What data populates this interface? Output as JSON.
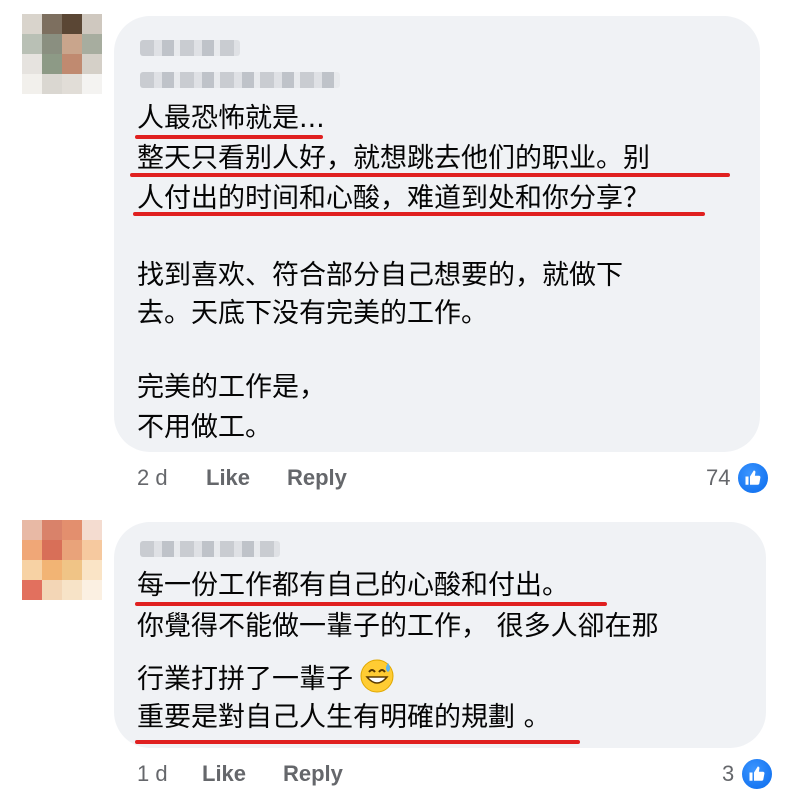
{
  "comments": [
    {
      "lines": [
        "人最恐怖就是...",
        "整天只看别人好，就想跳去他们的职业。别",
        "人付出的时间和心酸，难道到处和你分享？",
        "",
        "找到喜欢、符合部分自己想要的，就做下",
        "去。天底下没有完美的工作。",
        "",
        "完美的工作是，",
        "不用做工。"
      ],
      "time": "2 d",
      "like_label": "Like",
      "reply_label": "Reply",
      "reaction_count": "74"
    },
    {
      "lines": [
        "每一份工作都有自己的心酸和付出。",
        "你覺得不能做一輩子的工作， 很多人卻在那",
        "行業打拼了一輩子",
        "重要是對自己人生有明確的規劃 。"
      ],
      "emoji": "grinning-sweat-emoji",
      "time": "1 d",
      "like_label": "Like",
      "reply_label": "Reply",
      "reaction_count": "3"
    }
  ],
  "colors": {
    "bubble": "#f0f2f5",
    "underline": "#e02020",
    "meta_text": "#65676b",
    "like_blue": "#1877f2"
  },
  "icons": {
    "reaction": "thumbs-up-icon"
  }
}
